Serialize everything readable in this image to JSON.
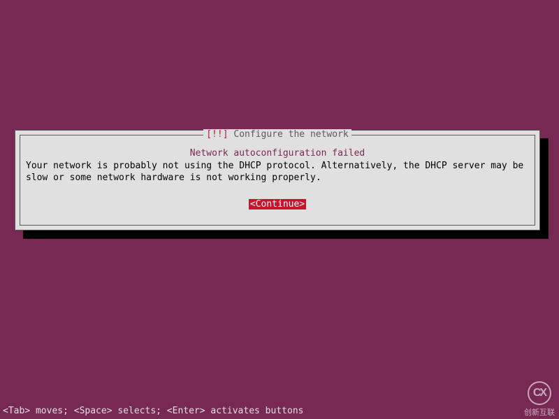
{
  "dialog": {
    "title_mark": "[!!]",
    "title_text": "Configure the network",
    "subtitle": "Network autoconfiguration failed",
    "body": "Your network is probably not using the DHCP protocol. Alternatively, the DHCP server may be slow or some network hardware is not working properly.",
    "continue": "<Continue>"
  },
  "hint": "<Tab> moves; <Space> selects; <Enter> activates buttons",
  "watermark": {
    "icon": "CX",
    "label": "创新互联"
  }
}
